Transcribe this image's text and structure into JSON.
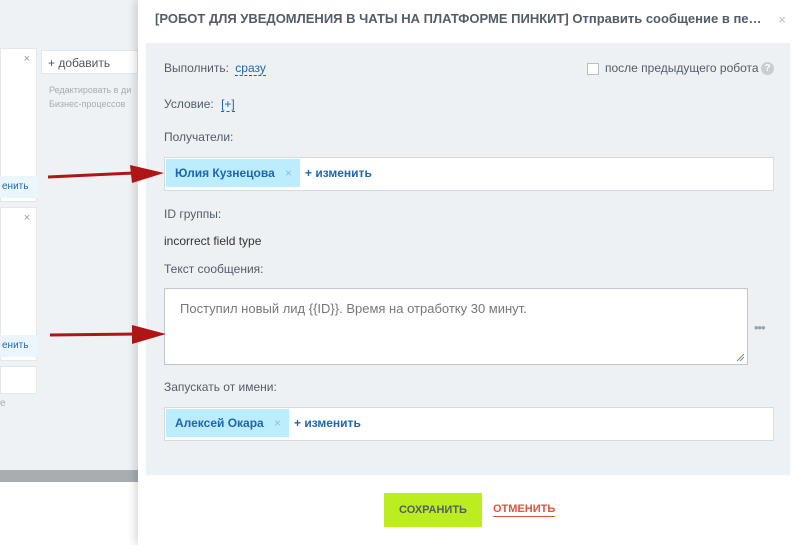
{
  "background": {
    "add_label": "+ добавить",
    "hint_text": "Редактировать в ди\nБизнес-процессов",
    "card_close": "×",
    "change_link_1": "енить",
    "change_link_2": "енить",
    "trailing_letter": "е"
  },
  "slider": {
    "title": "[РОБОТ ДЛЯ УВЕДОМЛЕНИЯ В ЧАТЫ НА ПЛАТФОРМЕ ПИНКИТ] Отправить сообщение в перс...",
    "close": "×"
  },
  "form": {
    "execute_label": "Выполнить:",
    "execute_value": "сразу",
    "after_previous_label": "после предыдущего робота",
    "help_glyph": "?",
    "condition_label": "Условие:",
    "condition_value": "[+]",
    "recipients_label": "Получатели:",
    "recipient_name": "Юлия Кузнецова",
    "chip_remove": "×",
    "change_label": "+  изменить",
    "group_id_label": "ID группы:",
    "group_id_value": "incorrect field type",
    "message_label": "Текст сообщения:",
    "message_value": "Поступил новый лид {{ID}}. Время на отработку 30 минут.",
    "more_glyph": "•••",
    "run_as_label": "Запускать от имени:",
    "run_as_name": "Алексей Окара",
    "run_as_change_label": "+  изменить"
  },
  "footer": {
    "save_label": "СОХРАНИТЬ",
    "cancel_label": "ОТМЕНИТЬ"
  },
  "colors": {
    "accent": "#2067b0",
    "save_button": "#bbed21",
    "cancel": "#e0533f",
    "chip": "#bcedfc",
    "arrow": "#b01515"
  },
  "icons": [
    "close-icon",
    "help-icon",
    "arrow-icon",
    "resize-handle-icon",
    "more-icon"
  ]
}
